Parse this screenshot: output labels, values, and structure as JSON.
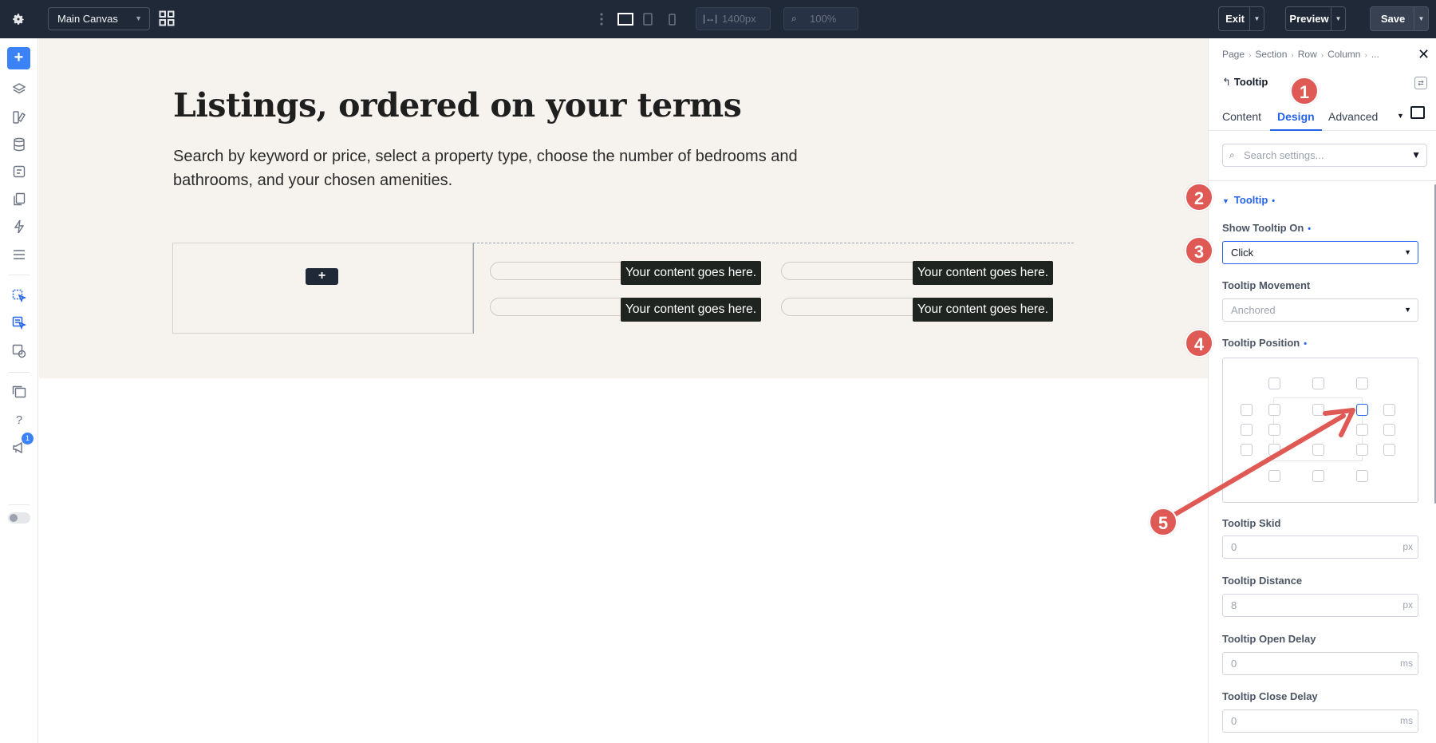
{
  "topbar": {
    "canvas_select": "Main Canvas",
    "width_value": "1400px",
    "zoom_value": "100%",
    "exit_label": "Exit",
    "preview_label": "Preview",
    "save_label": "Save",
    "icons": [
      "gear-icon",
      "grid-icon",
      "kebab-icon",
      "desktop-icon",
      "tablet-icon",
      "phone-icon",
      "width-icon",
      "zoom-icon"
    ]
  },
  "leftrail": {
    "notification_count": "1",
    "icons": [
      "add-icon",
      "layers-icon",
      "theme-builder-icon",
      "database-icon",
      "page-settings-icon",
      "pages-icon",
      "lightning-icon",
      "list-icon",
      "woo-icon",
      "woo-alt-icon",
      "globals-icon",
      "stack-icon",
      "help-icon",
      "megaphone-icon",
      "toggle-icon"
    ]
  },
  "canvas": {
    "heading": "Listings, ordered on your terms",
    "intro": "Search by keyword or price, select a property type, choose the number of bedrooms and bathrooms, and your chosen amenities.",
    "add_button": "+",
    "tooltips": [
      "Your content goes here.",
      "Your content goes here.",
      "Your content goes here.",
      "Your content goes here."
    ]
  },
  "panel": {
    "breadcrumb": [
      "Page",
      "Section",
      "Row",
      "Column",
      "..."
    ],
    "module_title": "Tooltip",
    "tabs": [
      "Content",
      "Design",
      "Advanced"
    ],
    "active_tab": "Design",
    "search_placeholder": "Search settings...",
    "group_title": "Tooltip",
    "fields": {
      "show_on_label": "Show Tooltip On",
      "show_on_value": "Click",
      "movement_label": "Tooltip Movement",
      "movement_value": "Anchored",
      "position_label": "Tooltip Position",
      "skid_label": "Tooltip Skid",
      "skid_value": "0",
      "skid_unit": "px",
      "distance_label": "Tooltip Distance",
      "distance_value": "8",
      "distance_unit": "px",
      "open_delay_label": "Tooltip Open Delay",
      "open_delay_value": "0",
      "open_delay_unit": "ms",
      "close_delay_label": "Tooltip Close Delay",
      "close_delay_value": "0",
      "close_delay_unit": "ms"
    },
    "accent_color": "#2563eb"
  },
  "annotations": {
    "markers": [
      "1",
      "2",
      "3",
      "4",
      "5"
    ],
    "color": "#e05a55"
  }
}
